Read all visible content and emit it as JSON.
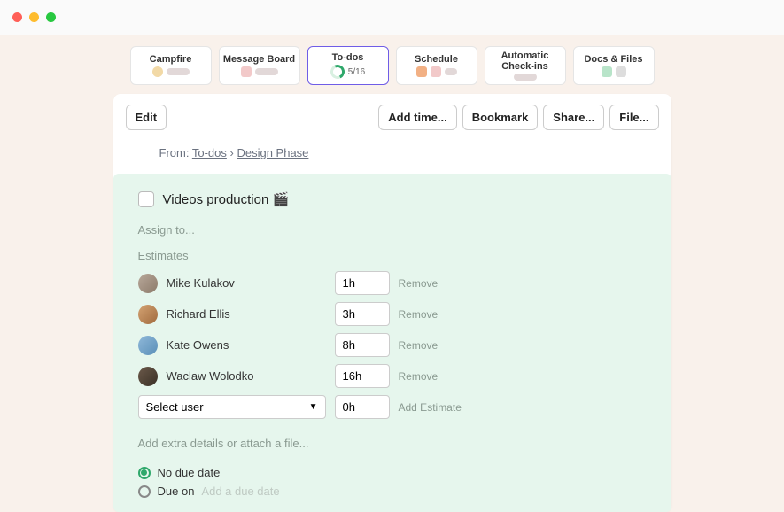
{
  "nav": {
    "tiles": [
      {
        "label": "Campfire",
        "active": false
      },
      {
        "label": "Message Board",
        "active": false
      },
      {
        "label": "To-dos",
        "active": true,
        "count": "5/16"
      },
      {
        "label": "Schedule",
        "active": false
      },
      {
        "label": "Automatic Check-ins",
        "active": false
      },
      {
        "label": "Docs & Files",
        "active": false
      }
    ]
  },
  "toolbar": {
    "edit": "Edit",
    "add_time": "Add time...",
    "bookmark": "Bookmark",
    "share": "Share...",
    "file": "File..."
  },
  "breadcrumb": {
    "prefix": "From:",
    "link1": "To-dos",
    "sep": "›",
    "link2": "Design Phase"
  },
  "todo": {
    "title": "Videos production 🎬",
    "assign_placeholder": "Assign to...",
    "estimates_heading": "Estimates",
    "people": [
      {
        "name": "Mike Kulakov",
        "time": "1h"
      },
      {
        "name": "Richard Ellis",
        "time": "3h"
      },
      {
        "name": "Kate Owens",
        "time": "8h"
      },
      {
        "name": "Waclaw Wolodko",
        "time": "16h"
      }
    ],
    "select_placeholder": "Select user",
    "new_time": "0h",
    "remove_label": "Remove",
    "add_estimate_label": "Add Estimate",
    "extra_details": "Add extra details or attach a file...",
    "no_due_label": "No due date",
    "due_on_label": "Due on",
    "due_placeholder": "Add a due date"
  }
}
